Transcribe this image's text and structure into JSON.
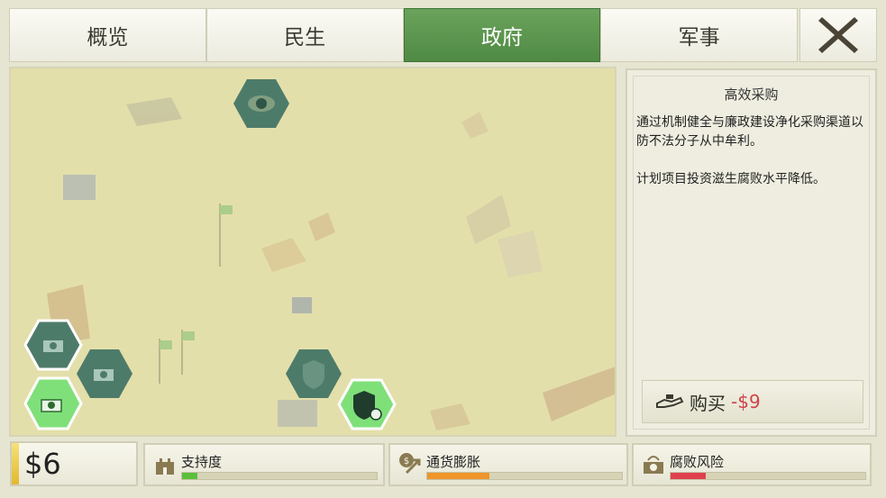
{
  "tabs": [
    {
      "label": "概览",
      "active": false
    },
    {
      "label": "民生",
      "active": false
    },
    {
      "label": "政府",
      "active": true
    },
    {
      "label": "军事",
      "active": false
    }
  ],
  "close_icon": "x-close-icon",
  "panel": {
    "title": "高效采购",
    "description": [
      "通过机制健全与廉政建设净化采购渠道以防不法分子从中牟利。",
      "计划项目投资滋生腐败水平降低。"
    ],
    "buy_label": "购买",
    "buy_cost": "-$9"
  },
  "money": "$6",
  "stats": [
    {
      "label": "支持度",
      "icon": "castle-icon",
      "level": 0.08,
      "color": "#5bbf3c"
    },
    {
      "label": "通货膨胀",
      "icon": "inflation-coin-icon",
      "level": 0.32,
      "color": "#f0952a"
    },
    {
      "label": "腐败风险",
      "icon": "bribe-icon",
      "level": 0.18,
      "color": "#e0404e"
    }
  ],
  "colors": {
    "active_tab": "#5a9650",
    "map_bg": "#e3dfab",
    "hex_dark": "#4d7b6a",
    "hex_bright": "#7fe07a"
  }
}
